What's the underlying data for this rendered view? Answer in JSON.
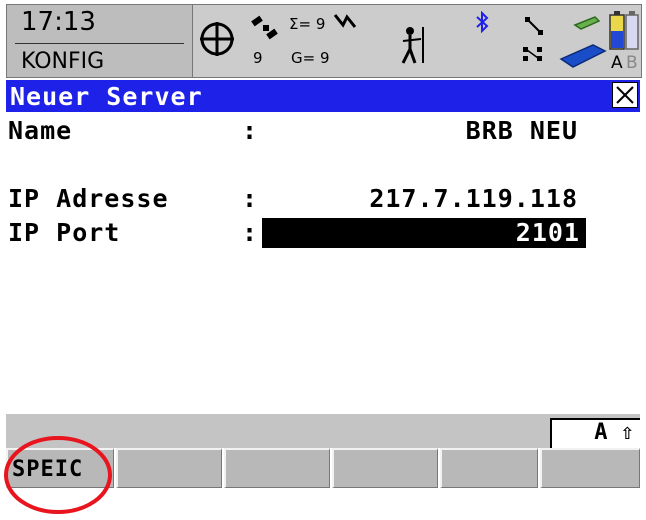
{
  "status": {
    "time": "17:13",
    "mode": "KONFIG",
    "satellites": {
      "total": "Σ= 9",
      "gps": "9",
      "glonass": "G= 9"
    },
    "icons": [
      "position-target-icon",
      "satellite-icon",
      "surveyor-icon",
      "bluetooth-icon",
      "link-icon",
      "radio-icon",
      "memory-card-icon",
      "battery-a-icon",
      "battery-b-icon"
    ],
    "battery_labels": {
      "a": "A",
      "b": "B"
    }
  },
  "dialog": {
    "title": "Neuer Server",
    "title_bg": "#1e22e8"
  },
  "fields": [
    {
      "label": "Name",
      "value": "BRB NEU",
      "selected": false
    },
    {
      "label": "IP Adresse",
      "value": "217.7.119.118",
      "selected": false
    },
    {
      "label": "IP Port",
      "value": "2101",
      "selected": true
    }
  ],
  "colon": ":",
  "input_mode": "A ⇧",
  "softkeys": [
    "SPEIC",
    "",
    "",
    "",
    "",
    ""
  ],
  "annotation_color": "#e8141e"
}
